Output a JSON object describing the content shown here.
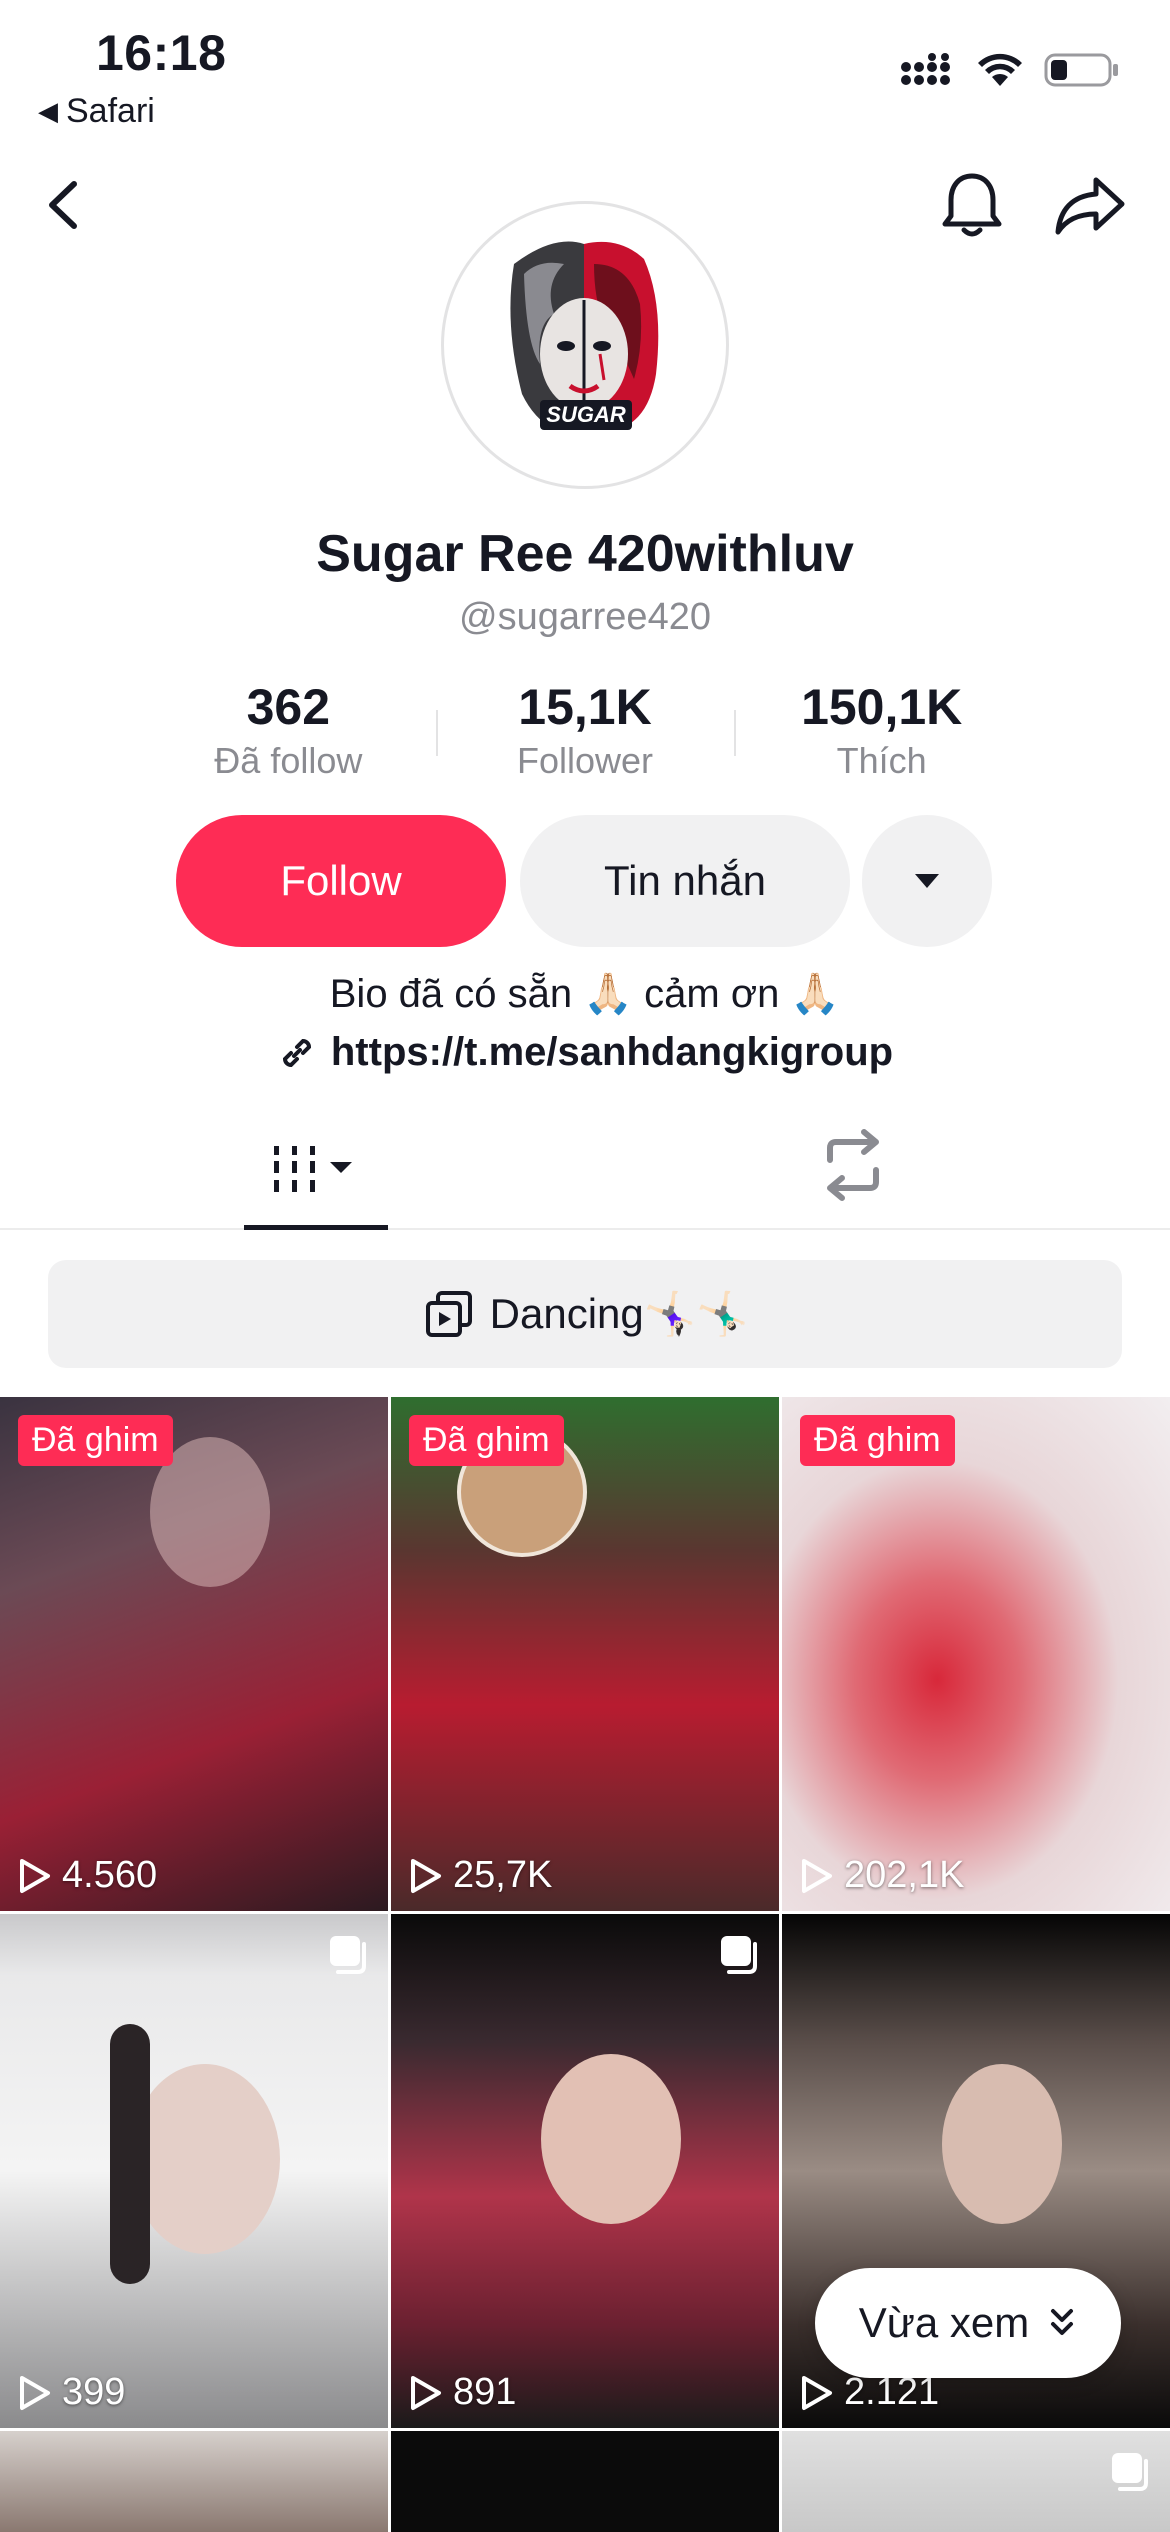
{
  "status_bar": {
    "time": "16:18",
    "back_app": "Safari"
  },
  "profile": {
    "display_name": "Sugar Ree 420withluv",
    "username": "@sugarree420",
    "avatar_text": "SUGAR"
  },
  "stats": [
    {
      "value": "362",
      "label": "Đã follow"
    },
    {
      "value": "15,1K",
      "label": "Follower"
    },
    {
      "value": "150,1K",
      "label": "Thích"
    }
  ],
  "actions": {
    "follow_label": "Follow",
    "message_label": "Tin nhắn"
  },
  "bio": {
    "text": "Bio đã có sẵn  🙏🏻 cảm ơn 🙏🏻",
    "link": "https://t.me/sanhdangkigroup"
  },
  "playlist": {
    "label": "Dancing🤸🏻‍♀️🤸🏻‍♂️"
  },
  "videos": [
    {
      "pinned_label": "Đã ghim",
      "views": "4.560"
    },
    {
      "pinned_label": "Đã ghim",
      "views": "25,7K"
    },
    {
      "pinned_label": "Đã ghim",
      "views": "202,1K"
    },
    {
      "views": "399"
    },
    {
      "views": "891"
    },
    {
      "views": "2.121"
    }
  ],
  "recent_pill": {
    "label": "Vừa xem"
  },
  "colors": {
    "accent": "#fe2c55",
    "text_primary": "#161823",
    "text_secondary": "#8a8b91",
    "button_gray": "#f1f1f2"
  }
}
